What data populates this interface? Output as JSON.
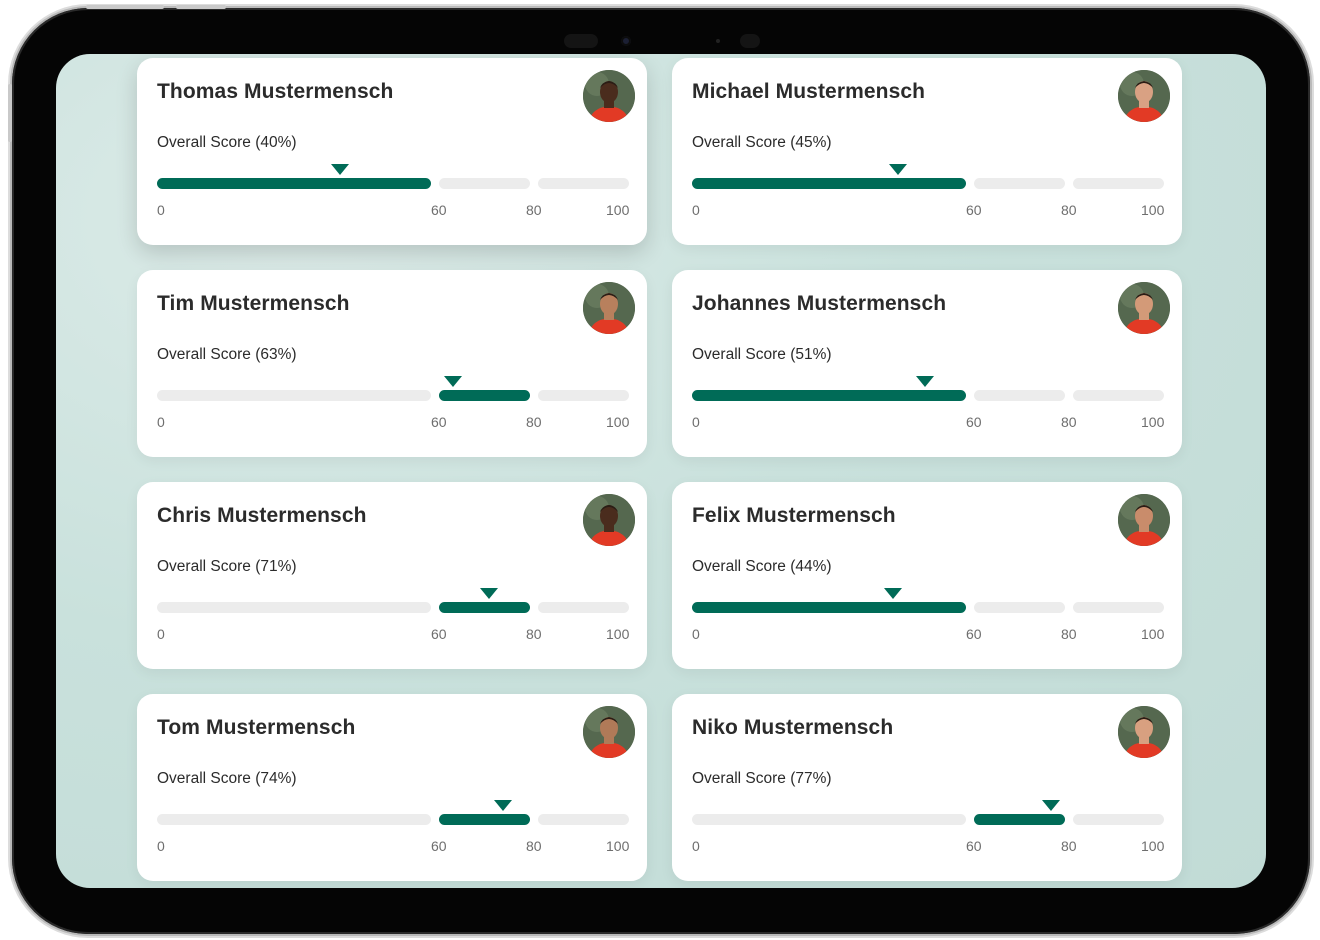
{
  "colors": {
    "accent": "#006b57",
    "track": "#ececec",
    "background": "#c9e1dc",
    "card": "#ffffff"
  },
  "scale": {
    "ticks": [
      "0",
      "60",
      "80",
      "100"
    ],
    "bands": [
      [
        0,
        60
      ],
      [
        60,
        80
      ],
      [
        80,
        100
      ]
    ]
  },
  "players": [
    {
      "name": "Thomas Mustermensch",
      "score_label": "Overall Score (40%)",
      "score": 40,
      "avatar_icon": "player-photo",
      "skin": "#4a2c1d"
    },
    {
      "name": "Michael Mustermensch",
      "score_label": "Overall Score (45%)",
      "score": 45,
      "avatar_icon": "player-photo",
      "skin": "#d9a183"
    },
    {
      "name": "Tim Mustermensch",
      "score_label": "Overall Score (63%)",
      "score": 63,
      "avatar_icon": "player-photo",
      "skin": "#b8805d"
    },
    {
      "name": "Johannes Mustermensch",
      "score_label": "Overall Score (51%)",
      "score": 51,
      "avatar_icon": "player-photo",
      "skin": "#d39a78"
    },
    {
      "name": "Chris Mustermensch",
      "score_label": "Overall Score (71%)",
      "score": 71,
      "avatar_icon": "player-photo",
      "skin": "#4a2c1d"
    },
    {
      "name": "Felix Mustermensch",
      "score_label": "Overall Score (44%)",
      "score": 44,
      "avatar_icon": "player-photo",
      "skin": "#c98c6b"
    },
    {
      "name": "Tom Mustermensch",
      "score_label": "Overall Score (74%)",
      "score": 74,
      "avatar_icon": "player-photo",
      "skin": "#b07a58"
    },
    {
      "name": "Niko Mustermensch",
      "score_label": "Overall Score (77%)",
      "score": 77,
      "avatar_icon": "player-photo",
      "skin": "#d8a080"
    }
  ]
}
